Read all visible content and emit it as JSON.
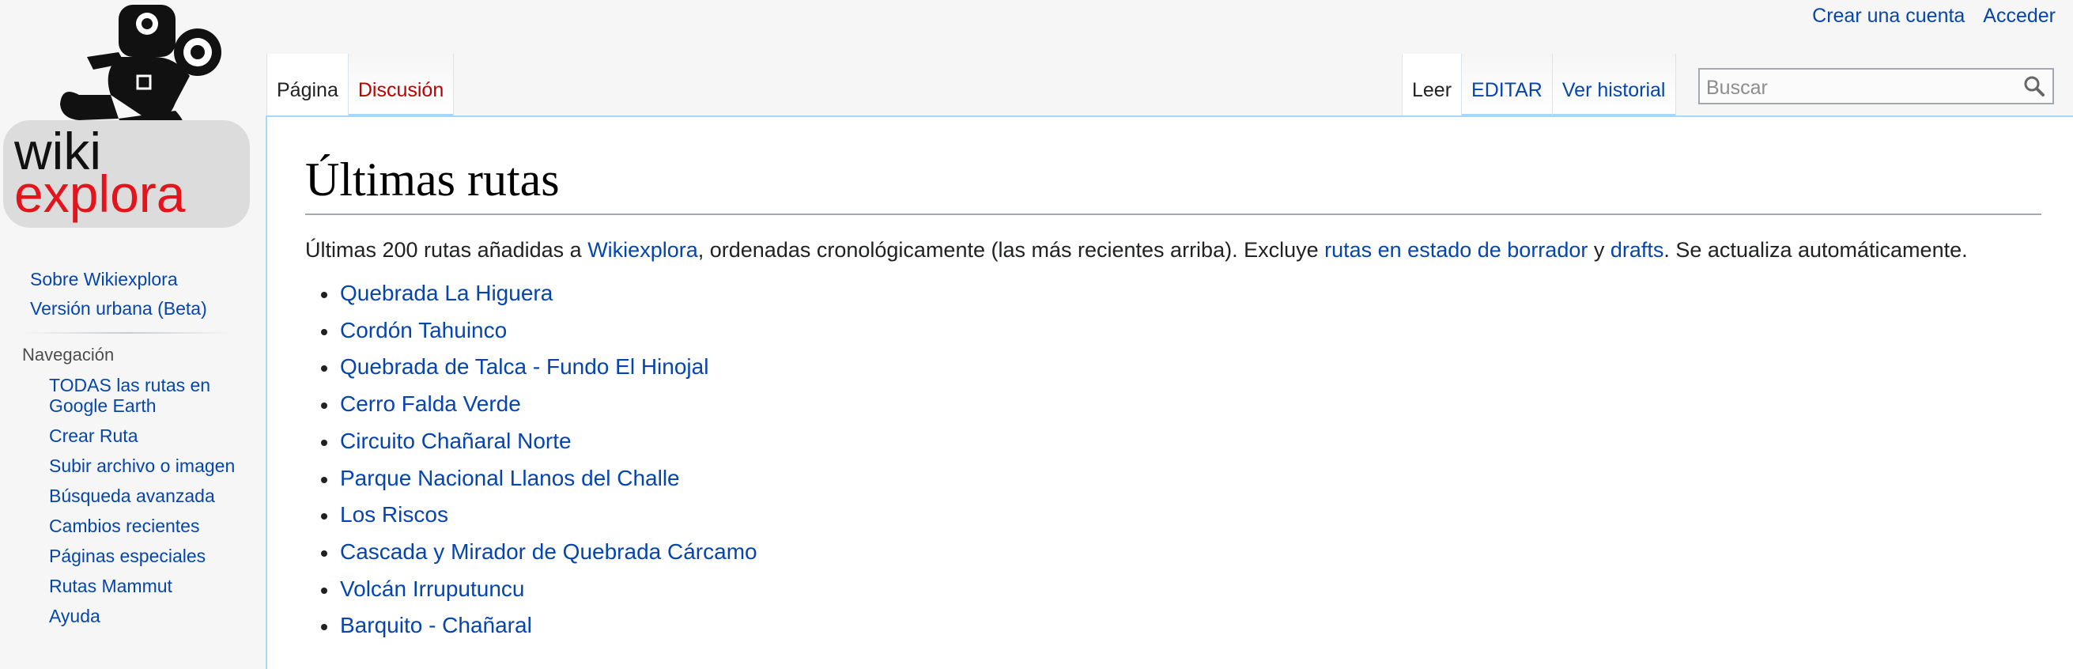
{
  "personal_tools": {
    "create_account": "Crear una cuenta",
    "login": "Acceder"
  },
  "logo": {
    "line1": "wiki",
    "line2": "explora",
    "colors": {
      "wiki": "#111111",
      "explora": "#e3141c",
      "badge": "#dcdcdc"
    }
  },
  "sidebar": {
    "top_links": [
      "Sobre Wikiexplora",
      "Versión urbana (Beta)"
    ],
    "nav_heading": "Navegación",
    "nav_items": [
      "TODAS las rutas en Google Earth",
      "Crear Ruta",
      "Subir archivo o imagen",
      "Búsqueda avanzada",
      "Cambios recientes",
      "Páginas especiales",
      "Rutas Mammut",
      "Ayuda"
    ]
  },
  "tabs": {
    "left": [
      "Página",
      "Discusión"
    ],
    "right": [
      "Leer",
      "EDITAR",
      "Ver historial"
    ]
  },
  "search": {
    "placeholder": "Buscar",
    "icon": "search-icon"
  },
  "content": {
    "title": "Últimas rutas",
    "intro": {
      "text1": "Últimas 200 rutas añadidas a ",
      "link1": "Wikiexplora",
      "text2": ", ordenadas cronológicamente (las más recientes arriba). Excluye ",
      "link2": "rutas en estado de borrador",
      "text3": " y ",
      "link3": "drafts",
      "text4": ". Se actualiza automáticamente."
    },
    "routes": [
      "Quebrada La Higuera",
      "Cordón Tahuinco",
      "Quebrada de Talca - Fundo El Hinojal",
      "Cerro Falda Verde",
      "Circuito Chañaral Norte",
      "Parque Nacional Llanos del Challe",
      "Los Riscos",
      "Cascada y Mirador de Quebrada Cárcamo",
      "Volcán Irruputuncu",
      "Barquito - Chañaral"
    ]
  },
  "colors": {
    "link": "#0645ad",
    "new_link": "#ba0000",
    "tab_border": "#a7d7f9"
  }
}
